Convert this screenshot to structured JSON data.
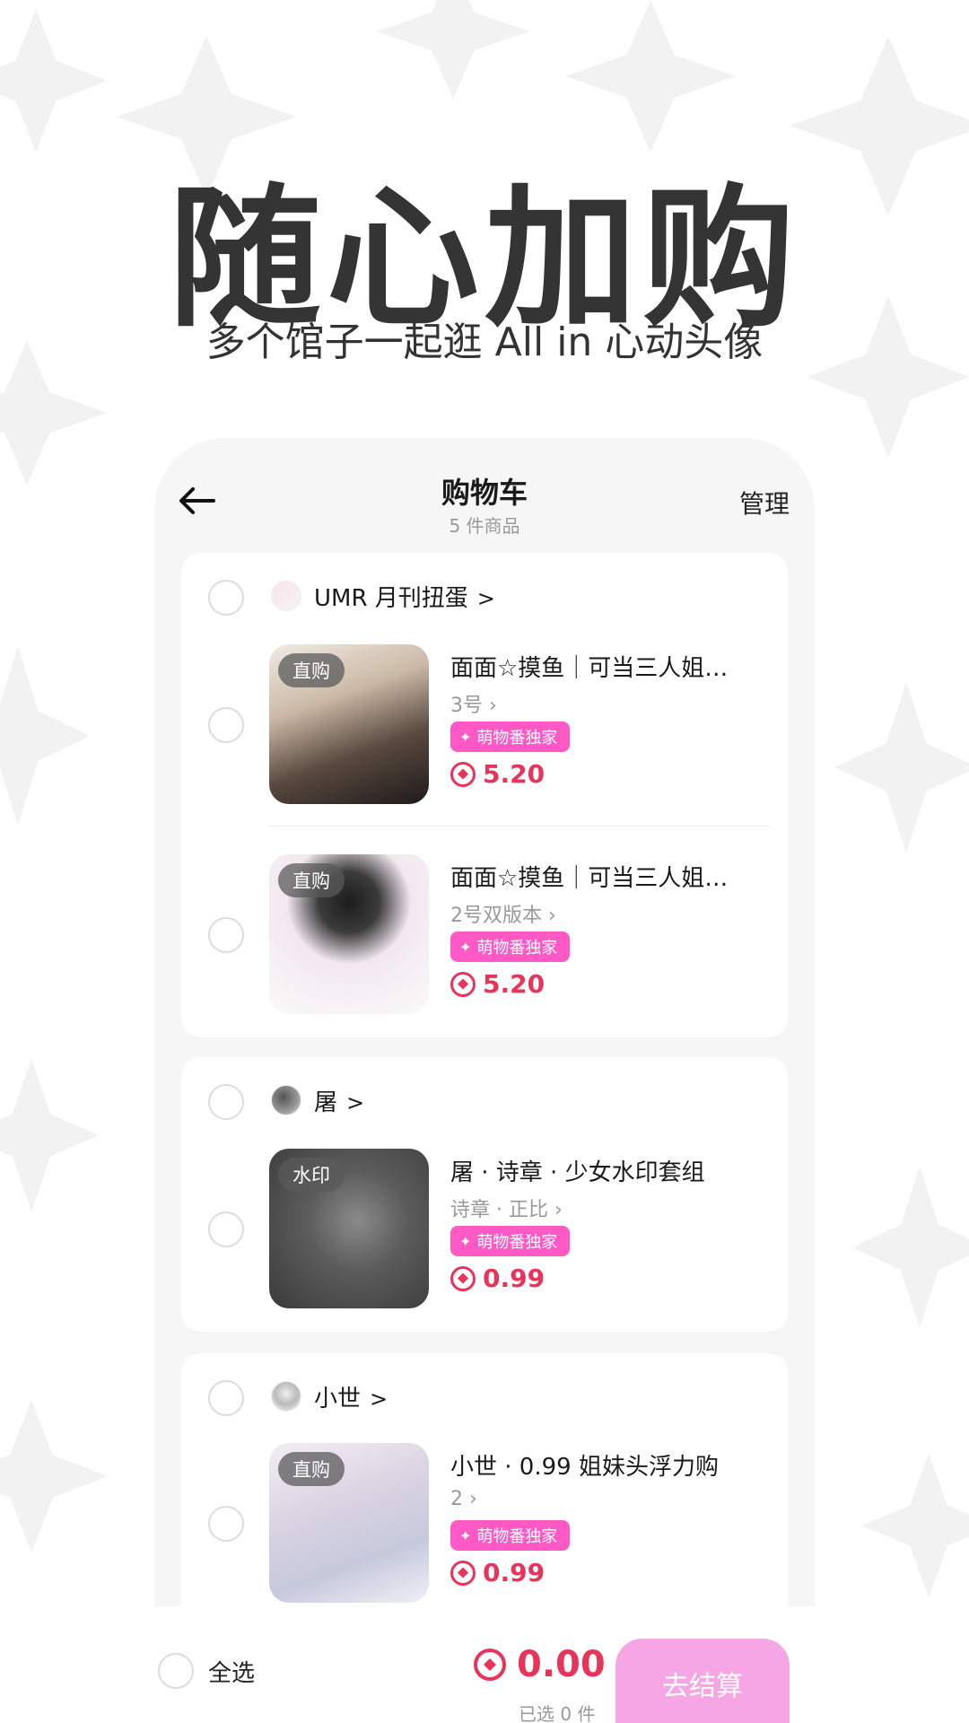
{
  "colors": {
    "accent_pink": "#ff59c6",
    "price_red": "#e8345a",
    "checkout_pink": "#f6a6e4",
    "title_dark": "#343434"
  },
  "hero": {
    "title": "随心加购",
    "subtitle": "多个馆子一起逛 All in 心动头像"
  },
  "nav": {
    "back_icon": "arrow-left-icon",
    "title": "购物车",
    "count": "5 件商品",
    "manage": "管理"
  },
  "shops": [
    {
      "name": "UMR 月刊扭蛋",
      "chevron": ">",
      "items": [
        {
          "tag": "直购",
          "title": "面面☆摸鱼｜可当三人姐…",
          "spec": "3号 ›",
          "badge": "萌物番独家",
          "price": "5.20"
        },
        {
          "tag": "直购",
          "title": "面面☆摸鱼｜可当三人姐…",
          "spec": "2号双版本 ›",
          "badge": "萌物番独家",
          "price": "5.20"
        }
      ]
    },
    {
      "name": "屠",
      "chevron": ">",
      "items": [
        {
          "tag": "水印",
          "title": "屠 · 诗章 · 少女水印套组",
          "spec": "诗章 · 正比 ›",
          "badge": "萌物番独家",
          "price": "0.99"
        }
      ]
    },
    {
      "name": "小世",
      "chevron": ">",
      "items": [
        {
          "tag": "直购",
          "title": "小世 · 0.99 姐妹头浮力购",
          "spec": "2 ›",
          "badge": "萌物番独家",
          "price": "0.99"
        }
      ]
    }
  ],
  "footer": {
    "select_all": "全选",
    "total": "0.00",
    "selected": "已选 0 件",
    "checkout": "去结算"
  }
}
